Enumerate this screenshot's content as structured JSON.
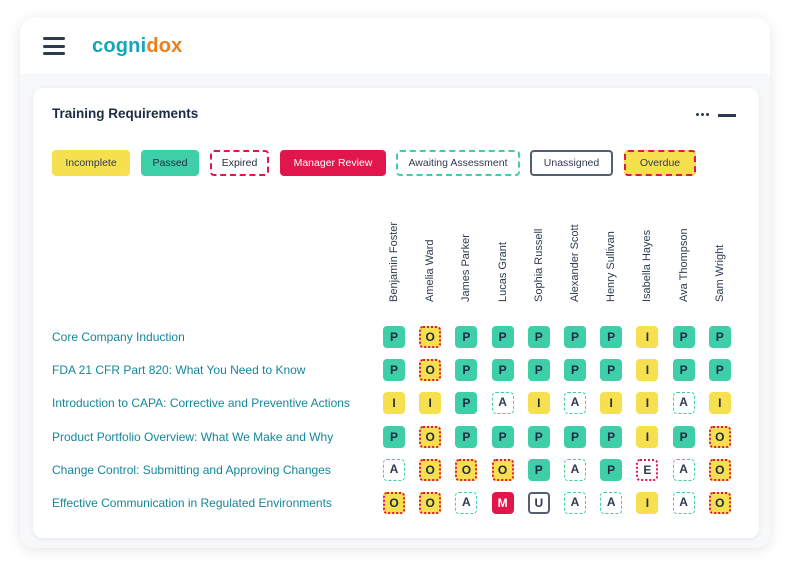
{
  "app": {
    "logo_part1": "cogni",
    "logo_part2": "dox"
  },
  "panel": {
    "title": "Training Requirements"
  },
  "legend": [
    {
      "label": "Incomplete",
      "style": "incomplete"
    },
    {
      "label": "Passed",
      "style": "passed"
    },
    {
      "label": "Expired",
      "style": "expired"
    },
    {
      "label": "Manager Review",
      "style": "manager"
    },
    {
      "label": "Awaiting Assessment",
      "style": "awaiting"
    },
    {
      "label": "Unassigned",
      "style": "unassigned"
    },
    {
      "label": "Overdue",
      "style": "overdue"
    }
  ],
  "people": [
    "Benjamin Foster",
    "Amelia Ward",
    "James Parker",
    "Lucas Grant",
    "Sophia Russell",
    "Alexander Scott",
    "Henry Sullivan",
    "Isabella Hayes",
    "Ava Thompson",
    "Sam Wright"
  ],
  "courses": [
    {
      "name": "Core Company Induction",
      "statuses": [
        "P",
        "O",
        "P",
        "P",
        "P",
        "P",
        "P",
        "I",
        "P",
        "P"
      ]
    },
    {
      "name": "FDA 21 CFR Part 820: What You Need to Know",
      "statuses": [
        "P",
        "O",
        "P",
        "P",
        "P",
        "P",
        "P",
        "I",
        "P",
        "P"
      ]
    },
    {
      "name": "Introduction to CAPA: Corrective and Preventive Actions",
      "statuses": [
        "I",
        "I",
        "P",
        "A",
        "I",
        "A",
        "I",
        "I",
        "A",
        "I"
      ]
    },
    {
      "name": "Product Portfolio Overview: What We Make and Why",
      "statuses": [
        "P",
        "O",
        "P",
        "P",
        "P",
        "P",
        "P",
        "I",
        "P",
        "O"
      ]
    },
    {
      "name": "Change Control: Submitting and Approving Changes",
      "statuses": [
        "A",
        "O",
        "O",
        "O",
        "P",
        "A",
        "P",
        "E",
        "A",
        "O"
      ]
    },
    {
      "name": "Effective Communication in Regulated Environments",
      "statuses": [
        "O",
        "O",
        "A",
        "M",
        "U",
        "A",
        "A",
        "I",
        "A",
        "O"
      ]
    }
  ],
  "colors": {
    "passed": "#3fcfa8",
    "incomplete": "#f7e04f",
    "manager": "#e1174c",
    "unassigned_border": "#54606f",
    "link": "#14879a",
    "logo_teal": "#14a6b8",
    "logo_orange": "#ef7d1a"
  }
}
